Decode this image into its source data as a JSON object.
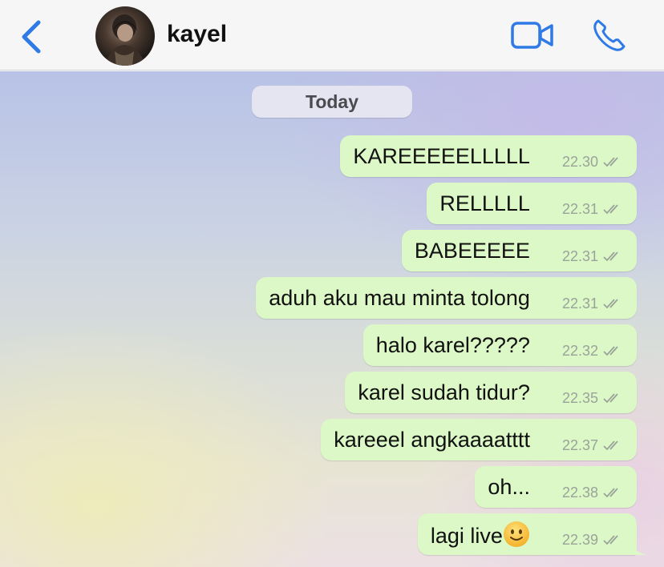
{
  "header": {
    "contact_name": "kayel",
    "back_icon": "chevron-left-icon",
    "video_icon": "video-camera-icon",
    "call_icon": "phone-icon",
    "accent_color": "#2f7ae5"
  },
  "chat": {
    "date_label": "Today",
    "bubble_color": "#dcf8c6",
    "messages": [
      {
        "text": "KAREEEEELLLLL",
        "time": "22.30"
      },
      {
        "text": "RELLLLL",
        "time": "22.31"
      },
      {
        "text": "BABEEEEE",
        "time": "22.31"
      },
      {
        "text": "aduh aku mau minta tolong",
        "time": "22.31"
      },
      {
        "text": "halo karel?????",
        "time": "22.32"
      },
      {
        "text": "karel sudah tidur?",
        "time": "22.35"
      },
      {
        "text": "kareeel angkaaaatttt",
        "time": "22.37"
      },
      {
        "text": "oh...",
        "time": "22.38"
      },
      {
        "text": "lagi live",
        "time": "22.39",
        "emoji": "slightly-smiling-face"
      }
    ]
  }
}
